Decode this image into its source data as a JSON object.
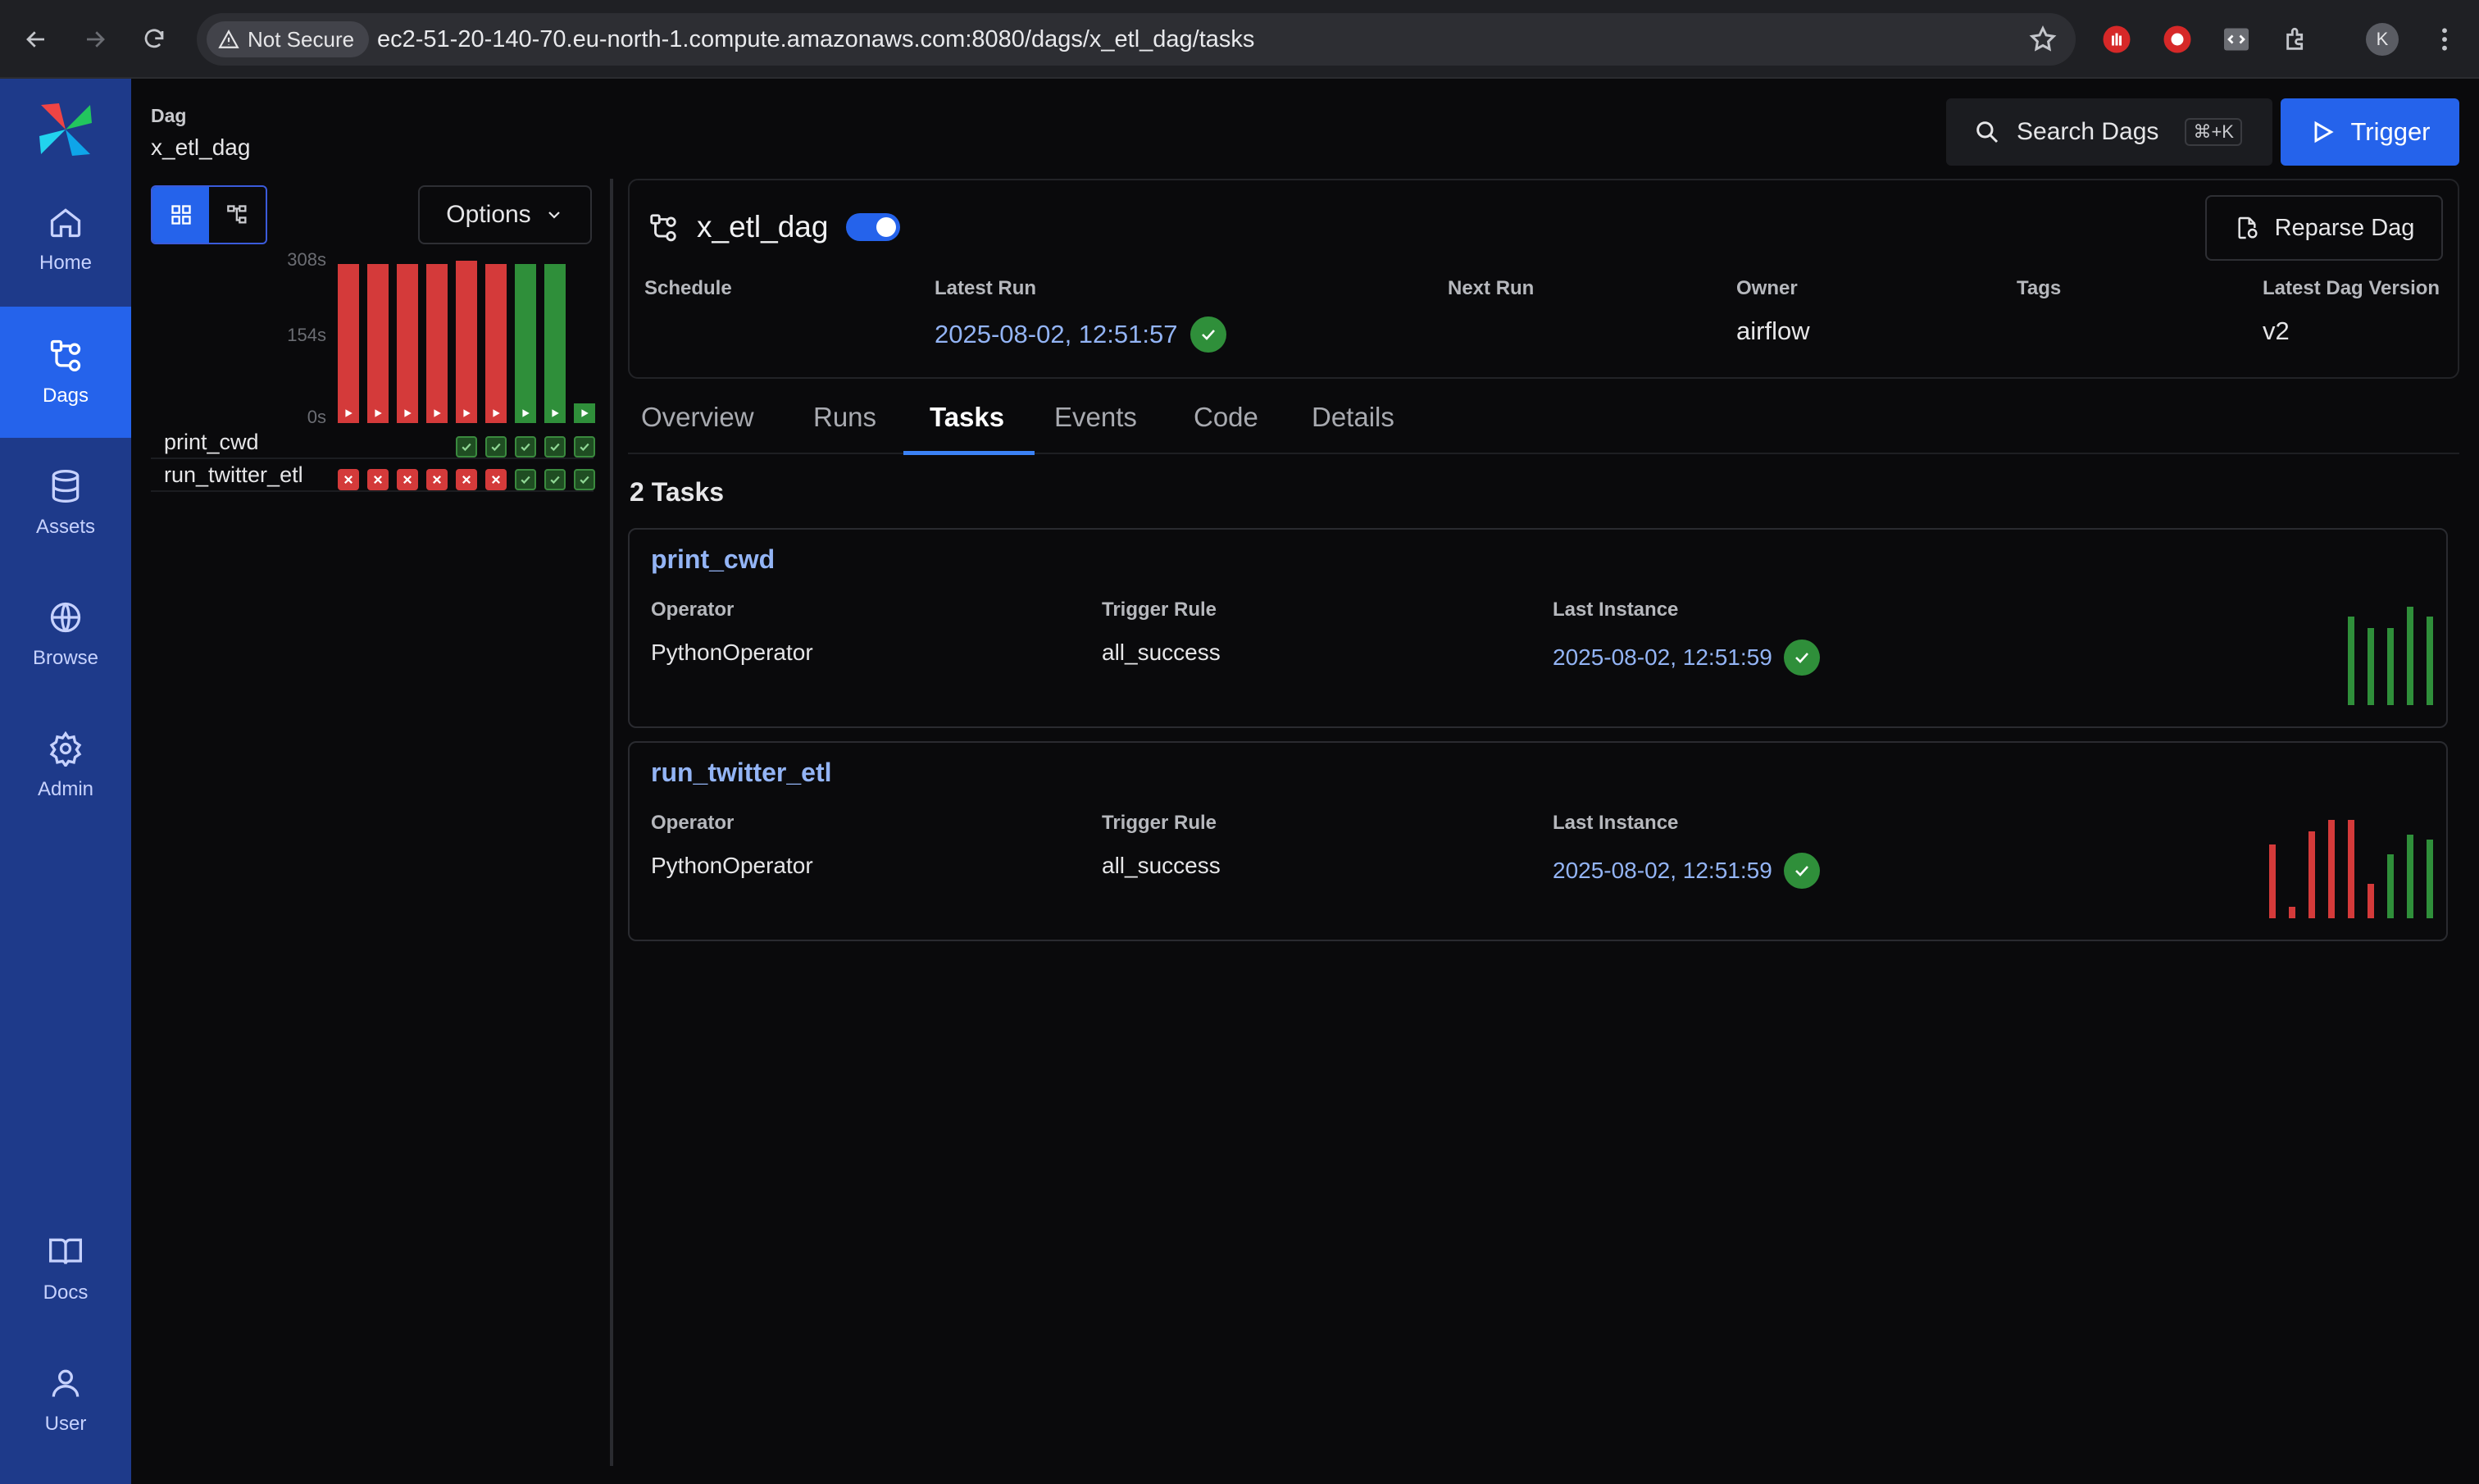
{
  "browser": {
    "security_label": "Not Secure",
    "url": "ec2-51-20-140-70.eu-north-1.compute.amazonaws.com:8080/dags/x_etl_dag/tasks",
    "profile_initial": "K"
  },
  "sidebar": {
    "items": [
      {
        "label": "Home",
        "icon": "home-icon"
      },
      {
        "label": "Dags",
        "icon": "dags-icon",
        "active": true
      },
      {
        "label": "Assets",
        "icon": "database-icon"
      },
      {
        "label": "Browse",
        "icon": "globe-icon"
      },
      {
        "label": "Admin",
        "icon": "gear-icon"
      },
      {
        "label": "Docs",
        "icon": "book-icon"
      },
      {
        "label": "User",
        "icon": "user-icon"
      }
    ]
  },
  "dag_panel": {
    "label": "Dag",
    "name": "x_etl_dag",
    "options_label": "Options",
    "axis": [
      "308s",
      "154s",
      "0s"
    ],
    "runs": [
      {
        "state": "failed",
        "fraction": 0.97
      },
      {
        "state": "failed",
        "fraction": 0.97
      },
      {
        "state": "failed",
        "fraction": 0.97
      },
      {
        "state": "failed",
        "fraction": 0.97
      },
      {
        "state": "failed",
        "fraction": 0.99
      },
      {
        "state": "failed",
        "fraction": 0.97
      },
      {
        "state": "success",
        "fraction": 0.97
      },
      {
        "state": "success",
        "fraction": 0.97
      },
      {
        "state": "success",
        "fraction": 0.0
      }
    ],
    "task_rows": [
      {
        "name": "print_cwd",
        "states": [
          "",
          "",
          "",
          "",
          "success",
          "success",
          "success",
          "success",
          "success"
        ]
      },
      {
        "name": "run_twitter_etl",
        "states": [
          "failed",
          "failed",
          "failed",
          "failed",
          "failed",
          "failed",
          "success",
          "success",
          "success"
        ]
      }
    ]
  },
  "actions": {
    "search_label": "Search Dags",
    "search_shortcut": "⌘+K",
    "trigger_label": "Trigger"
  },
  "header": {
    "dag_id": "x_etl_dag",
    "paused": false,
    "reparse_label": "Reparse Dag",
    "meta": {
      "schedule_label": "Schedule",
      "schedule_value": "",
      "latest_run_label": "Latest Run",
      "latest_run_value": "2025-08-02, 12:51:57",
      "next_run_label": "Next Run",
      "next_run_value": "",
      "owner_label": "Owner",
      "owner_value": "airflow",
      "tags_label": "Tags",
      "tags_value": "",
      "version_label": "Latest Dag Version",
      "version_value": "v2"
    }
  },
  "tabs": [
    "Overview",
    "Runs",
    "Tasks",
    "Events",
    "Code",
    "Details"
  ],
  "active_tab": "Tasks",
  "tasks_count": "2 Tasks",
  "task_labels": {
    "operator": "Operator",
    "trigger_rule": "Trigger Rule",
    "last_instance": "Last Instance"
  },
  "tasks": [
    {
      "name": "print_cwd",
      "operator": "PythonOperator",
      "trigger_rule": "all_success",
      "last_instance": "2025-08-02, 12:51:59",
      "history": [
        {
          "state": "success",
          "fraction": 0.9
        },
        {
          "state": "success",
          "fraction": 0.78
        },
        {
          "state": "success",
          "fraction": 0.78
        },
        {
          "state": "success",
          "fraction": 1.0
        },
        {
          "state": "success",
          "fraction": 0.9
        }
      ]
    },
    {
      "name": "run_twitter_etl",
      "operator": "PythonOperator",
      "trigger_rule": "all_success",
      "last_instance": "2025-08-02, 12:51:59",
      "history": [
        {
          "state": "failed",
          "fraction": 0.75
        },
        {
          "state": "failed",
          "fraction": 0.12
        },
        {
          "state": "failed",
          "fraction": 0.88
        },
        {
          "state": "failed",
          "fraction": 1.0
        },
        {
          "state": "failed",
          "fraction": 1.0
        },
        {
          "state": "failed",
          "fraction": 0.35
        },
        {
          "state": "success",
          "fraction": 0.65
        },
        {
          "state": "success",
          "fraction": 0.85
        },
        {
          "state": "success",
          "fraction": 0.8
        }
      ]
    }
  ],
  "colors": {
    "success": "#2f8f3a",
    "failed": "#d43a3a",
    "accent": "#2563eb",
    "link": "#93b4f5"
  }
}
